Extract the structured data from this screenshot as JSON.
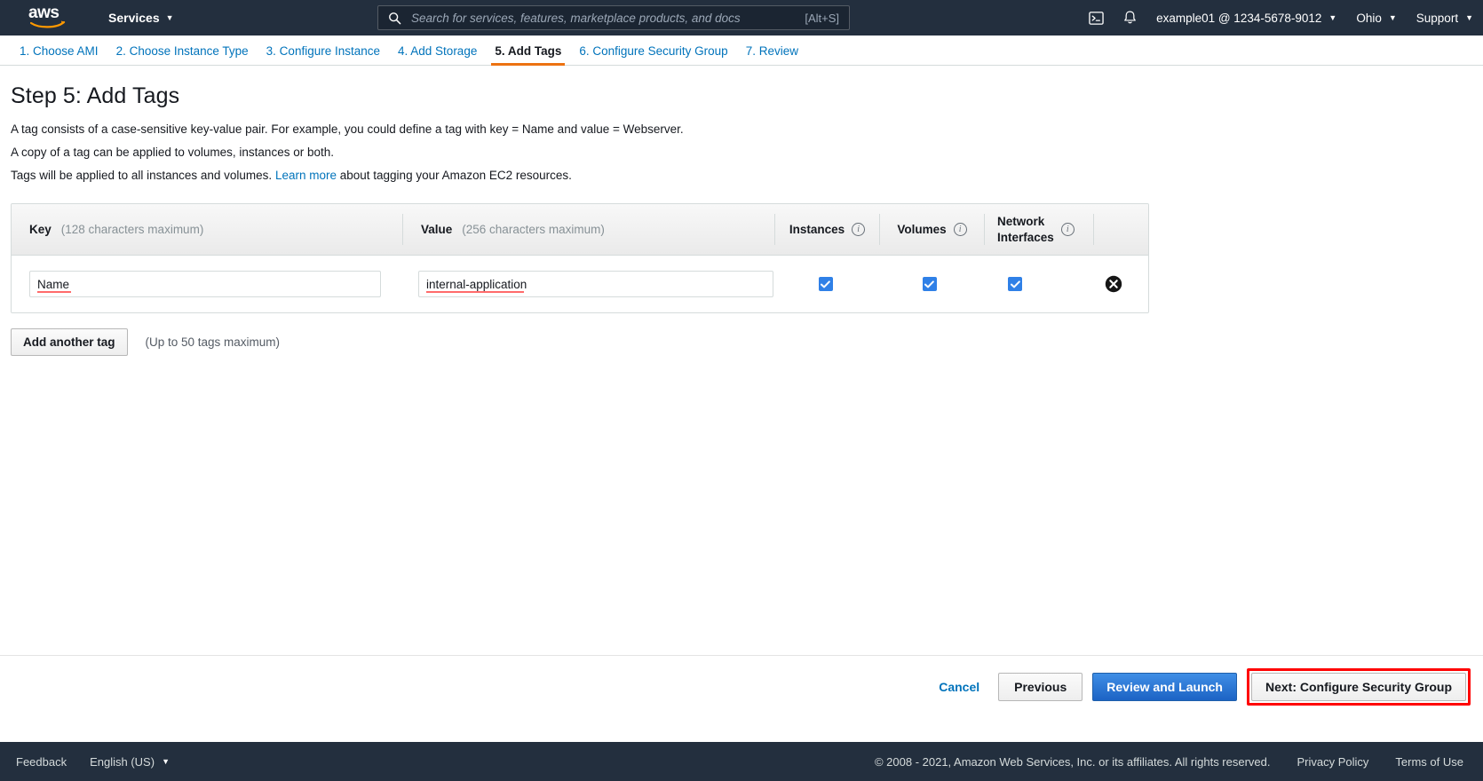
{
  "topnav": {
    "logo_text": "aws",
    "services_label": "Services",
    "search": {
      "placeholder": "Search for services, features, marketplace products, and docs",
      "shortcut": "[Alt+S]"
    },
    "cloudshell_icon": "cloudshell-icon",
    "bell_icon": "notifications-bell-icon",
    "account_label": "example01 @ 1234-5678-9012",
    "region_label": "Ohio",
    "support_label": "Support",
    "caret": "▼"
  },
  "wizard": {
    "tabs": [
      {
        "label": "1. Choose AMI",
        "active": false
      },
      {
        "label": "2. Choose Instance Type",
        "active": false
      },
      {
        "label": "3. Configure Instance",
        "active": false
      },
      {
        "label": "4. Add Storage",
        "active": false
      },
      {
        "label": "5. Add Tags",
        "active": true
      },
      {
        "label": "6. Configure Security Group",
        "active": false
      },
      {
        "label": "7. Review",
        "active": false
      }
    ]
  },
  "page": {
    "title": "Step 5: Add Tags",
    "desc1": "A tag consists of a case-sensitive key-value pair. For example, you could define a tag with key = Name and value = Webserver.",
    "desc2": "A copy of a tag can be applied to volumes, instances or both.",
    "desc3_before": "Tags will be applied to all instances and volumes.",
    "desc3_link": "Learn more",
    "desc3_after": "about tagging your Amazon EC2 resources."
  },
  "table": {
    "key_header": "Key",
    "key_hint": "(128 characters maximum)",
    "value_header": "Value",
    "value_hint": "(256 characters maximum)",
    "instances_header": "Instances",
    "volumes_header": "Volumes",
    "network_header_line1": "Network",
    "network_header_line2": "Interfaces",
    "info_icon": "info-icon",
    "rows": [
      {
        "key": "Name",
        "value": "internal-application",
        "instances_checked": true,
        "volumes_checked": true,
        "network_checked": true,
        "delete_icon": "remove-tag-icon"
      }
    ]
  },
  "actions": {
    "add_tag_label": "Add another tag",
    "add_tag_hint": "(Up to 50 tags maximum)",
    "cancel_label": "Cancel",
    "previous_label": "Previous",
    "review_label": "Review and Launch",
    "next_label": "Next: Configure Security Group",
    "next_highlight_color": "#ff0000"
  },
  "footer": {
    "feedback_label": "Feedback",
    "language_label": "English (US)",
    "copyright": "© 2008 - 2021, Amazon Web Services, Inc. or its affiliates. All rights reserved.",
    "privacy_label": "Privacy Policy",
    "terms_label": "Terms of Use"
  },
  "colors": {
    "nav_bg": "#232f3e",
    "link": "#0073bb",
    "active_underline": "#ec7211",
    "checkbox": "#2f80e7",
    "primary_button": "#1c63c4"
  }
}
